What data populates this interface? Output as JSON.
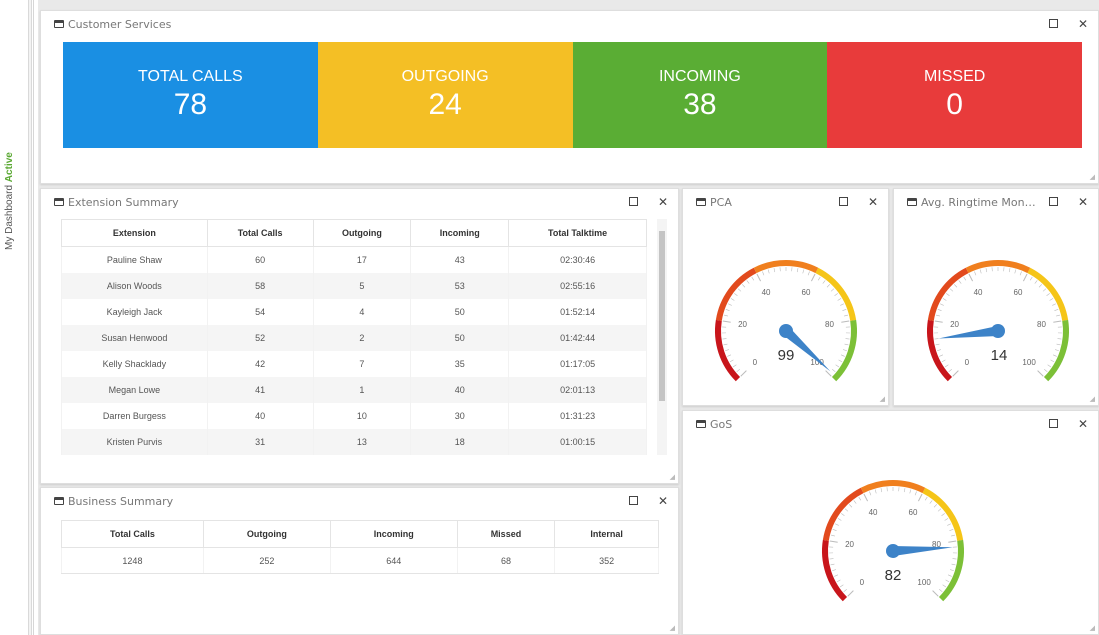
{
  "sidebar": {
    "label": "My Dashboard",
    "status": "Active"
  },
  "customer_services": {
    "title": "Customer Services",
    "kpis": [
      {
        "label": "TOTAL CALLS",
        "value": "78",
        "color": "#1a8fe3"
      },
      {
        "label": "OUTGOING",
        "value": "24",
        "color": "#f4bf25"
      },
      {
        "label": "INCOMING",
        "value": "38",
        "color": "#5aad34"
      },
      {
        "label": "MISSED",
        "value": "0",
        "color": "#e83b3b"
      }
    ]
  },
  "extension_summary": {
    "title": "Extension Summary",
    "columns": [
      "Extension",
      "Total Calls",
      "Outgoing",
      "Incoming",
      "Total Talktime"
    ],
    "rows": [
      [
        "Pauline Shaw",
        "60",
        "17",
        "43",
        "02:30:46"
      ],
      [
        "Alison Woods",
        "58",
        "5",
        "53",
        "02:55:16"
      ],
      [
        "Kayleigh Jack",
        "54",
        "4",
        "50",
        "01:52:14"
      ],
      [
        "Susan Henwood",
        "52",
        "2",
        "50",
        "01:42:44"
      ],
      [
        "Kelly Shacklady",
        "42",
        "7",
        "35",
        "01:17:05"
      ],
      [
        "Megan Lowe",
        "41",
        "1",
        "40",
        "02:01:13"
      ],
      [
        "Darren Burgess",
        "40",
        "10",
        "30",
        "01:31:23"
      ],
      [
        "Kristen Purvis",
        "31",
        "13",
        "18",
        "01:00:15"
      ]
    ]
  },
  "business_summary": {
    "title": "Business Summary",
    "columns": [
      "Total Calls",
      "Outgoing",
      "Incoming",
      "Missed",
      "Internal"
    ],
    "values": [
      "1248",
      "252",
      "644",
      "68",
      "352"
    ]
  },
  "gauges": {
    "pca": {
      "title": "PCA",
      "value": "99",
      "ticks": [
        "0",
        "20",
        "40",
        "60",
        "80",
        "100"
      ]
    },
    "ringtime": {
      "title": "Avg. Ringtime Moni...",
      "value": "14",
      "ticks": [
        "0",
        "20",
        "40",
        "60",
        "80",
        "100"
      ]
    },
    "gos": {
      "title": "GoS",
      "value": "82",
      "ticks": [
        "0",
        "20",
        "40",
        "60",
        "80",
        "100"
      ]
    }
  },
  "icons": {
    "window": "window-icon",
    "maximize": "maximize-icon",
    "close": "close-icon"
  }
}
